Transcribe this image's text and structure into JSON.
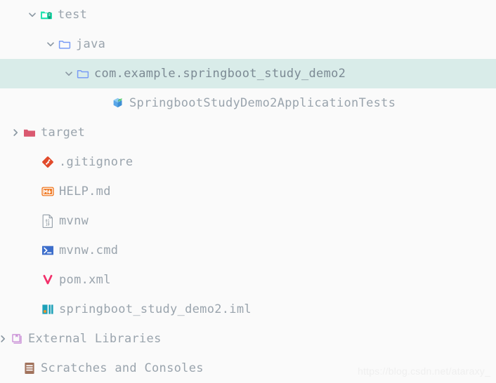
{
  "watermark": "https://blog.csdn.net/ataraxy_",
  "colors": {
    "background": "#fafafa",
    "selection": "#d9ece9",
    "text": "#9aa4ad",
    "test_folder": "#22e3b0",
    "java_folder": "#7a9cf5",
    "target_folder": "#da5970",
    "git_icon": "#e14a2b",
    "markdown_icon": "#f07b26",
    "cmd_icon": "#3d6ecb",
    "maven_icon": "#f2306a",
    "iml_icon": "#1da1b8",
    "library_icon": "#cb93d8",
    "scratch_icon": "#a1725c",
    "class_icon": "#59a6e8"
  },
  "tree": {
    "items": [
      {
        "id": "test",
        "label": "test",
        "icon": "test-source-folder-icon",
        "indent": 36,
        "chevron": "down",
        "selected": false
      },
      {
        "id": "java",
        "label": "java",
        "icon": "folder-icon",
        "indent": 62,
        "chevron": "down",
        "selected": false
      },
      {
        "id": "package",
        "label": "com.example.springboot_study_demo2",
        "icon": "package-folder-icon",
        "indent": 88,
        "chevron": "down",
        "selected": true
      },
      {
        "id": "test-class",
        "label": "SpringbootStudyDemo2ApplicationTests",
        "icon": "java-test-class-icon",
        "indent": 138,
        "chevron": "none",
        "selected": false
      },
      {
        "id": "target",
        "label": "target",
        "icon": "excluded-folder-icon",
        "indent": 12,
        "chevron": "right",
        "selected": false
      },
      {
        "id": "gitignore",
        "label": ".gitignore",
        "icon": "git-file-icon",
        "indent": 38,
        "chevron": "none",
        "selected": false
      },
      {
        "id": "help-md",
        "label": "HELP.md",
        "icon": "markdown-file-icon",
        "indent": 38,
        "chevron": "none",
        "selected": false
      },
      {
        "id": "mvnw",
        "label": "mvnw",
        "icon": "binary-file-icon",
        "indent": 38,
        "chevron": "none",
        "selected": false
      },
      {
        "id": "mvnw-cmd",
        "label": "mvnw.cmd",
        "icon": "cmd-file-icon",
        "indent": 38,
        "chevron": "none",
        "selected": false
      },
      {
        "id": "pom-xml",
        "label": "pom.xml",
        "icon": "maven-pom-icon",
        "indent": 38,
        "chevron": "none",
        "selected": false
      },
      {
        "id": "iml",
        "label": "springboot_study_demo2.iml",
        "icon": "intellij-module-icon",
        "indent": 38,
        "chevron": "none",
        "selected": false
      },
      {
        "id": "external-libraries",
        "label": "External Libraries",
        "icon": "library-icon",
        "indent": -6,
        "chevron": "right",
        "selected": false
      },
      {
        "id": "scratches",
        "label": "Scratches and Consoles",
        "icon": "scratches-icon",
        "indent": 12,
        "chevron": "none",
        "selected": false
      }
    ]
  }
}
